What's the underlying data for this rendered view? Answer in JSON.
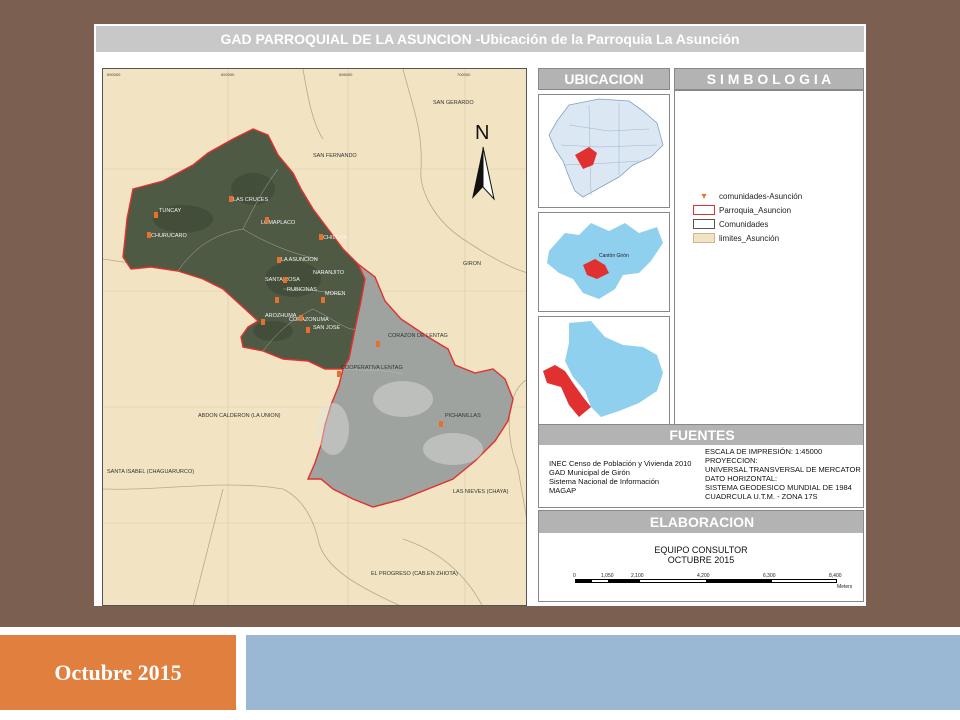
{
  "map": {
    "title": "GAD PARROQUIAL DE LA ASUNCION -Ubicación de la Parroquia La Asunción",
    "north_label": "N",
    "neighbors": [
      "SAN GERARDO",
      "SAN FERNANDO",
      "GIRON",
      "ABDON CALDERON (LA UNION)",
      "SANTA ISABEL (CHAGUARURCO)",
      "LAS NIEVES (CHAYA)",
      "EL PROGRESO (CAB.EN ZHIOTA)"
    ],
    "communities": [
      "TUNCAY",
      "CHURUCARO",
      "LAS CRUCES",
      "LOMAPLACO",
      "CHILCHIL",
      "LA ASUNCION",
      "SANTA ROSA",
      "NARANJITO",
      "RUBICINAS",
      "MOREN",
      "AROZHUMA",
      "CORAZONUMA",
      "SAN JOSE",
      "CORAZON DE LENTAG",
      "COOPERATIVA LENTAG",
      "PICHANILLAS"
    ],
    "top_ticks": [
      "690000",
      "692000",
      "696000",
      "700000"
    ],
    "left_ticks": [
      "9660000",
      "9652000",
      "9648000",
      "9644000"
    ]
  },
  "ubicacion": {
    "header": "UBICACION",
    "canton_label": "Cantón Girón"
  },
  "simbologia": {
    "header": "S I M B O L O G I A",
    "items": [
      {
        "label": "comunidades-Asunción",
        "icon": "community-marker-icon",
        "color": "#e8702a"
      },
      {
        "label": "Parroquia_Asuncion",
        "color": "#e03030"
      },
      {
        "label": "Comunidades",
        "color": "#ffffff"
      },
      {
        "label": "limites_Asunción",
        "color": "#f2e4c2"
      }
    ]
  },
  "fuentes": {
    "header": "FUENTES",
    "sources": [
      "INEC Censo de Población y Vivienda 2010",
      "GAD Municipal de Girón",
      "Sistema Nacional de Información",
      "MAGAP"
    ],
    "details": [
      "ESCALA DE IMPRESIÓN: 1:45000",
      "PROYECCION:",
      "UNIVERSAL TRANSVERSAL DE MERCATOR",
      "DATO HORIZONTAL:",
      "SISTEMA GEODESICO MUNDIAL DE 1984",
      "CUADRCULA U.T.M. - ZONA 17S"
    ]
  },
  "elaboracion": {
    "header": "ELABORACION",
    "team": "EQUIPO CONSULTOR",
    "date": "OCTUBRE 2015",
    "scale_ticks": [
      "0",
      "1,050",
      "2,100",
      "4,200",
      "6,300",
      "8,400"
    ],
    "scale_unit": "Meters"
  },
  "footer": {
    "date": "Octubre 2015"
  },
  "colors": {
    "background": "#7b5f51",
    "footer_orange": "#e07f3e",
    "footer_blue": "#9ab8d4",
    "parish_red": "#e03030",
    "locator_blue": "#8fd0ef",
    "land_beige": "#f2e4c2"
  }
}
